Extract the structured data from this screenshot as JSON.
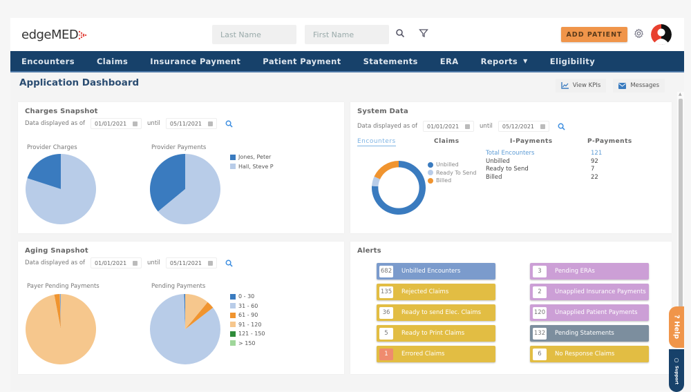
{
  "header": {
    "logo_text": "edgeMED",
    "logo_dots": "⁘",
    "last_name_placeholder": "Last Name",
    "first_name_placeholder": "First Name",
    "add_patient_label": "ADD PATIENT"
  },
  "nav": {
    "items": [
      {
        "label": "Encounters"
      },
      {
        "label": "Claims"
      },
      {
        "label": "Insurance Payment"
      },
      {
        "label": "Patient Payment"
      },
      {
        "label": "Statements"
      },
      {
        "label": "ERA"
      },
      {
        "label": "Reports",
        "caret": "⌄"
      },
      {
        "label": "Eligibility"
      }
    ]
  },
  "page": {
    "title": "Application Dashboard",
    "view_kpis_label": "View KPIs",
    "messages_label": "Messages"
  },
  "charges_snapshot": {
    "title": "Charges Snapshot",
    "date_prefix": "Data displayed as of",
    "from": "01/01/2021",
    "until_label": "until",
    "to": "05/11/2021",
    "provider_charges_label": "Provider Charges",
    "provider_payments_label": "Provider Payments",
    "legend": [
      "Jones, Peter",
      "Hall, Steve P"
    ]
  },
  "system_data": {
    "title": "System Data",
    "date_prefix": "Data displayed as of",
    "from": "01/01/2021",
    "until_label": "until",
    "to": "05/12/2021",
    "tabs": [
      "Encounters",
      "Claims",
      "I-Payments",
      "P-Payments"
    ],
    "active_tab": "Encounters",
    "legend": [
      "Unbilled",
      "Ready To Send",
      "Billed"
    ],
    "stats": [
      {
        "label": "Total Encounters",
        "value": "121"
      },
      {
        "label": "Unbilled",
        "value": "92"
      },
      {
        "label": "Ready to Send",
        "value": "7"
      },
      {
        "label": "Billed",
        "value": "22"
      }
    ]
  },
  "aging_snapshot": {
    "title": "Aging Snapshot",
    "date_prefix": "Data displayed as of",
    "from": "01/01/2021",
    "until_label": "until",
    "to": "05/11/2021",
    "payer_pending_label": "Payer Pending Payments",
    "pending_payments_label": "Pending Payments",
    "legend": [
      "0 - 30",
      "31 - 60",
      "61 - 90",
      "91 - 120",
      "121 - 150",
      "> 150"
    ]
  },
  "alerts": {
    "title": "Alerts",
    "left": [
      {
        "count": "682",
        "label": "Unbilled Encounters",
        "color": "#7b9bcc"
      },
      {
        "count": "135",
        "label": "Rejected Claims",
        "color": "#e2bd43"
      },
      {
        "count": "36",
        "label": "Ready to send Elec. Claims",
        "color": "#e2bd43"
      },
      {
        "count": "5",
        "label": "Ready to Print Claims",
        "color": "#e2bd43"
      },
      {
        "count": "1",
        "label": "Errored Claims",
        "color": "#e2bd43",
        "error": true
      }
    ],
    "right": [
      {
        "count": "3",
        "label": "Pending ERAs",
        "color": "#cc9fd6"
      },
      {
        "count": "2",
        "label": "Unapplied Insurance Payments",
        "color": "#cc9fd6"
      },
      {
        "count": "120",
        "label": "Unapplied Patient Payments",
        "color": "#cc9fd6"
      },
      {
        "count": "132",
        "label": "Pending Statements",
        "color": "#7c8e9e"
      },
      {
        "count": "6",
        "label": "No Response Claims",
        "color": "#e2bd43"
      }
    ]
  },
  "side_tabs": {
    "help": "? Help",
    "support": "Support"
  },
  "colors": {
    "nav_bg": "#17416a",
    "accent_orange": "#f0954a",
    "pie_dark_blue": "#3a7bbf",
    "pie_light_blue": "#b8cce8",
    "pie_orange": "#f0942f",
    "pie_light_orange": "#f6c78d",
    "pie_dark_green": "#2e8b3a",
    "pie_light_green": "#9fd69a"
  },
  "chart_data": [
    {
      "type": "pie",
      "title": "Provider Charges",
      "categories": [
        "Jones, Peter",
        "Hall, Steve P"
      ],
      "values": [
        20,
        80
      ]
    },
    {
      "type": "pie",
      "title": "Provider Payments",
      "categories": [
        "Jones, Peter",
        "Hall, Steve P"
      ],
      "values": [
        36,
        64
      ]
    },
    {
      "type": "pie",
      "title": "Encounters",
      "donut": true,
      "categories": [
        "Unbilled",
        "Ready To Send",
        "Billed"
      ],
      "values": [
        92,
        7,
        22
      ]
    },
    {
      "type": "pie",
      "title": "Payer Pending Payments",
      "categories": [
        "0 - 30",
        "31 - 60",
        "61 - 90",
        "91 - 120",
        "121 - 150",
        "> 150"
      ],
      "values": [
        0.2,
        0.3,
        2.5,
        97,
        0,
        0
      ]
    },
    {
      "type": "pie",
      "title": "Pending Payments",
      "categories": [
        "0 - 30",
        "31 - 60",
        "61 - 90",
        "91 - 120",
        "121 - 150",
        "> 150"
      ],
      "values": [
        0.5,
        85,
        3.5,
        11,
        0,
        0
      ]
    }
  ]
}
